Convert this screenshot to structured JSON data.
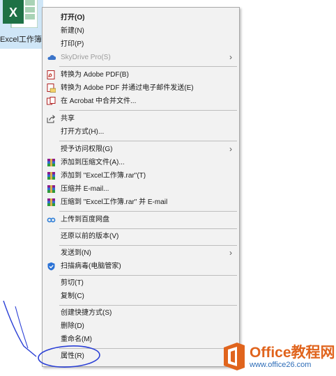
{
  "desktop_file": {
    "name": "Excel工作簿.xlsx",
    "logo_letter": "X",
    "icon": "excel-file-icon"
  },
  "menu": {
    "items": [
      {
        "label": "打开(O)",
        "bold": true
      },
      {
        "label": "新建(N)"
      },
      {
        "label": "打印(P)"
      },
      {
        "label": "SkyDrive Pro(S)",
        "disabled": true,
        "submenu": true
      },
      {
        "label": "转换为 Adobe PDF(B)"
      },
      {
        "label": "转换为 Adobe PDF 并通过电子邮件发送(E)"
      },
      {
        "label": "在 Acrobat 中合并文件..."
      },
      {
        "label": "共享"
      },
      {
        "label": "打开方式(H)..."
      },
      {
        "label": "授予访问权限(G)",
        "submenu": true
      },
      {
        "label": "添加到压缩文件(A)..."
      },
      {
        "label": "添加到 \"Excel工作簿.rar\"(T)"
      },
      {
        "label": "压缩并 E-mail..."
      },
      {
        "label": "压缩到 \"Excel工作簿.rar\" 并 E-mail"
      },
      {
        "label": "上传到百度网盘"
      },
      {
        "label": "还原以前的版本(V)"
      },
      {
        "label": "发送到(N)",
        "submenu": true
      },
      {
        "label": "扫描病毒(电脑管家)"
      },
      {
        "label": "剪切(T)"
      },
      {
        "label": "复制(C)"
      },
      {
        "label": "创建快捷方式(S)"
      },
      {
        "label": "删除(D)"
      },
      {
        "label": "重命名(M)"
      },
      {
        "label": "属性(R)"
      }
    ],
    "submenu_glyph": "›"
  },
  "watermark": {
    "title": "Office教程网",
    "url": "www.office26.com"
  },
  "colors": {
    "accent_blue": "#2a3fd6",
    "excel_green": "#1e7145",
    "watermark_orange": "#e0641d"
  }
}
